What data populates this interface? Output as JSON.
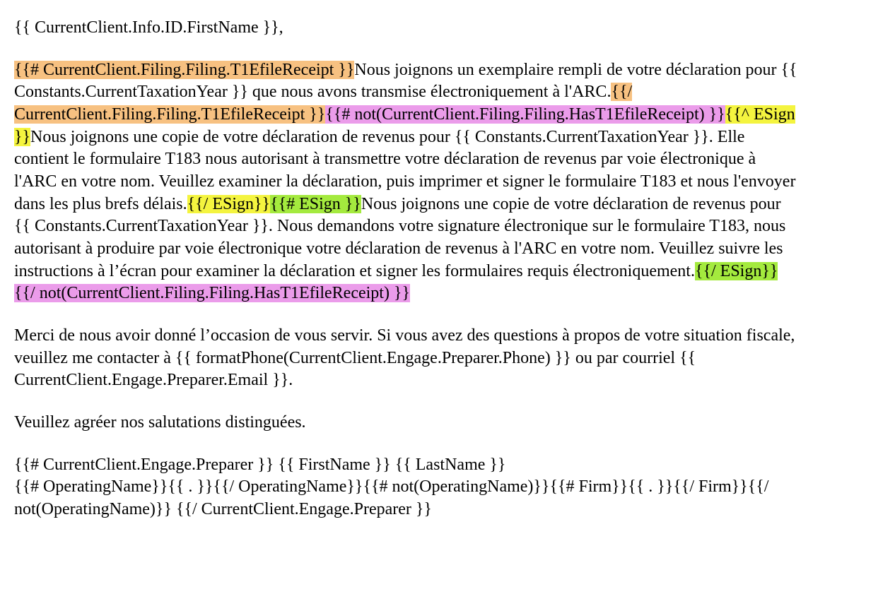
{
  "greeting": "{{ CurrentClient.Info.ID.FirstName }},",
  "para1": {
    "tag_open_receipt": "{{# CurrentClient.Filing.Filing.T1EfileReceipt }}",
    "text1_a": "Nous joignons un exemplaire rempli de votre déclaration pour ",
    "tax_year_1": "{{ Constants.CurrentTaxationYear }}",
    "text1_b": " que nous avons transmise électroniquement à l'ARC.",
    "tag_close_receipt": "{{/ CurrentClient.Filing.Filing.T1EfileReceipt }}",
    "tag_open_not_a": "{{# ",
    "tag_open_not_b": "not(CurrentClient.Filing.Filing.HasT1EfileReceipt) }}",
    "tag_esign_inv": "{{^ ESign }}",
    "text2_a": "Nous joignons une copie de votre déclaration de revenus pour ",
    "tax_year_2": "{{ Constants.CurrentTaxationYear }}",
    "text2_b": ". Elle contient le formulaire T183 nous autorisant à transmettre votre déclaration de revenus par voie électronique à l'ARC en votre nom. Veuillez examiner la déclaration, puis imprimer et signer le formulaire T183 et nous l'envoyer dans les plus brefs délais.",
    "tag_esign_inv_close": "{{/ ESign}}",
    "tag_esign_open": "{{# ESign }}",
    "text3_a": "Nous joignons une copie de votre déclaration de revenus pour ",
    "tax_year_3": "{{ Constants.CurrentTaxationYear }}",
    "text3_b": ". Nous demandons votre signature électronique sur le formulaire T183, nous autorisant à produire par voie électronique votre déclaration de revenus à l'ARC en votre nom. Veuillez suivre les instructions à l’écran pour examiner la déclaration et signer les formulaires requis électroniquement.",
    "tag_esign_close": "{{/ ESign}}",
    "tag_close_not": "{{/ not(CurrentClient.Filing.Filing.HasT1EfileReceipt) }}"
  },
  "para2_a": "Merci de nous avoir donné l’occasion de vous servir. Si vous avez des questions à propos de votre situation fiscale, veuillez me contacter à ",
  "phone": "{{ formatPhone(CurrentClient.Engage.Preparer.Phone) }}",
  "para2_b": " ou par courriel ",
  "email": "{{ CurrentClient.Engage.Preparer.Email }}",
  "para2_c": ".",
  "signoff": "Veuillez agréer nos salutations distinguées.",
  "sig": {
    "l1_a": "{{# CurrentClient.Engage.Preparer }}",
    "l1_b": " {{ FirstName }} ",
    "l1_c": "{{ LastName }}",
    "l2": "{{# OperatingName}}{{ . }}{{/ OperatingName}}{{# not(OperatingName)}}{{# Firm}}{{ . }}{{/ Firm}}{{/ not(OperatingName)}} {{/ CurrentClient.Engage.Preparer }}"
  }
}
